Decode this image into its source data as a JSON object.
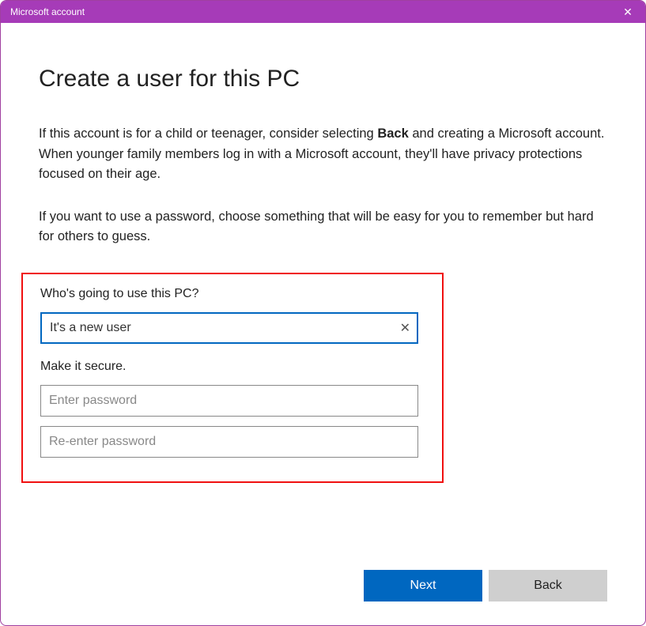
{
  "titlebar": {
    "title": "Microsoft account"
  },
  "heading": "Create a user for this PC",
  "paragraph1": {
    "pre": "If this account is for a child or teenager, consider selecting ",
    "bold": "Back",
    "post": " and creating a Microsoft account. When younger family members log in with a Microsoft account, they'll have privacy protections focused on their age."
  },
  "paragraph2": "If you want to use a password, choose something that will be easy for you to remember but hard for others to guess.",
  "form": {
    "who_label": "Who's going to use this PC?",
    "username_value": "It's a new user",
    "secure_label": "Make it secure.",
    "password_placeholder": "Enter password",
    "reenter_placeholder": "Re-enter password"
  },
  "footer": {
    "next_label": "Next",
    "back_label": "Back"
  },
  "colors": {
    "accent_purple": "#a63bb8",
    "focus_blue": "#0067c0",
    "highlight_red": "#f01010"
  }
}
